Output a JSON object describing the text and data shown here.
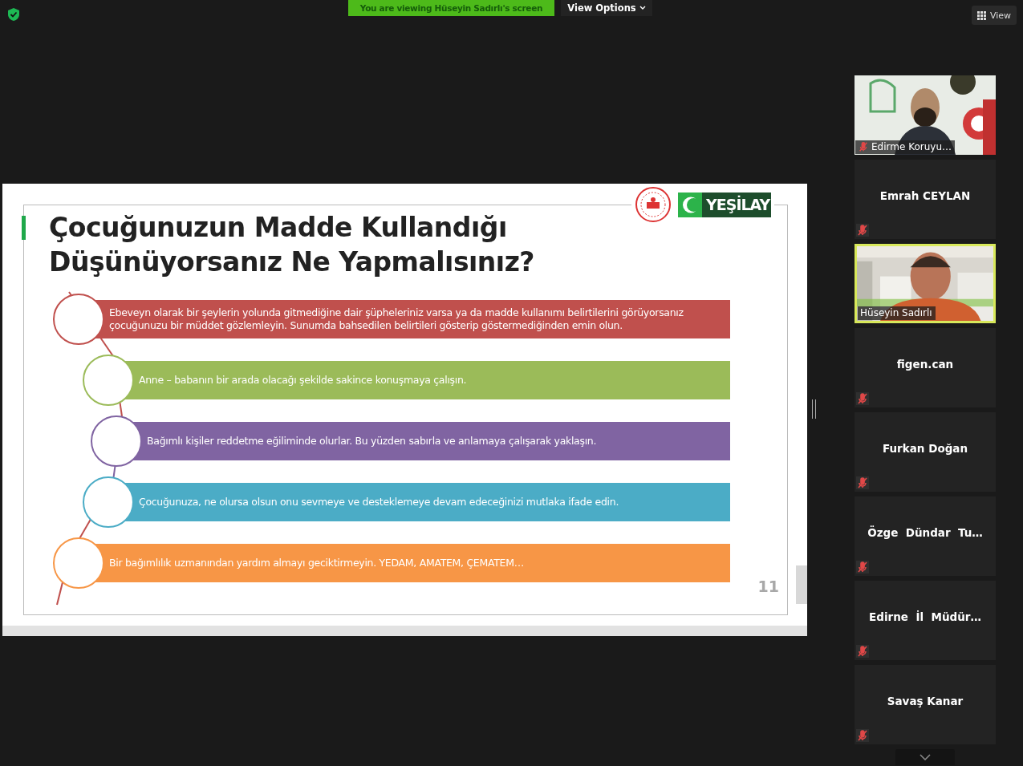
{
  "top_bar": {
    "banner": "You are viewing Hüseyin Sadırlı's screen",
    "view_options": "View Options",
    "view": "View"
  },
  "slide": {
    "title_lines": [
      "Çocuğunuzun Madde Kullandığı",
      "Düşünüyorsanız Ne Yapmalısınız?"
    ],
    "logo_text": "YEŞİLAY",
    "items": [
      {
        "text": "Ebeveyn olarak bir şeylerin yolunda gitmediğine dair şüpheleriniz varsa ya da madde kullanımı belirtilerini görüyorsanız çocuğunuzu bir müddet gözlemleyin.  Sunumda bahsedilen belirtileri gösterip göstermediğinden emin olun.",
        "color": "#c0504d"
      },
      {
        "text": "Anne – babanın bir arada olacağı  şekilde sakince konuşmaya çalışın.",
        "color": "#9bbb59"
      },
      {
        "text": "Bağımlı kişiler reddetme eğiliminde olurlar. Bu yüzden sabırla ve anlamaya çalışarak yaklaşın.",
        "color": "#8064a2"
      },
      {
        "text": "Çocuğunuza, ne olursa olsun onu sevmeye ve desteklemeye devam edeceğinizi mutlaka ifade edin.",
        "color": "#4bacc6"
      },
      {
        "text": "Bir bağımlılık uzmanından yardım almayı geciktirmeyin. YEDAM, AMATEM, ÇEMATEM…",
        "color": "#f79646"
      }
    ],
    "page_number": "11"
  },
  "participants": [
    {
      "name": "Edirme Koruyu…",
      "kind": "video",
      "muted": true,
      "selected": false
    },
    {
      "name": "Emrah CEYLAN",
      "kind": "name",
      "muted": true,
      "selected": false
    },
    {
      "name": "Hüseyin Sadırlı",
      "kind": "video",
      "muted": false,
      "selected": true
    },
    {
      "name": "figen.can",
      "kind": "name",
      "muted": true,
      "selected": false
    },
    {
      "name": "Furkan Doğan",
      "kind": "name",
      "muted": true,
      "selected": false
    },
    {
      "name": "Özge  Dündar  Tu…",
      "kind": "name",
      "muted": true,
      "selected": false
    },
    {
      "name": "Edirne  İl  Müdür…",
      "kind": "name",
      "muted": true,
      "selected": false
    },
    {
      "name": "Savaş Kanar",
      "kind": "name",
      "muted": true,
      "selected": false
    }
  ]
}
